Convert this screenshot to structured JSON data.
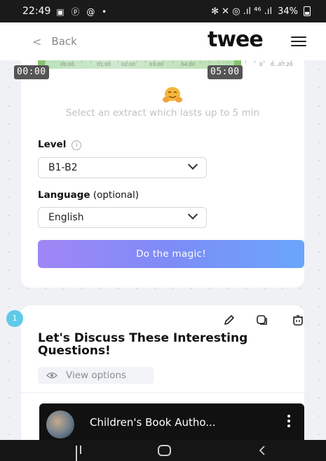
{
  "status_bar": {
    "time": "22:49",
    "notification_icons": "▣ ⓟ @ •",
    "connectivity": "✻ ✕ ◎ .ıl ⁴⁶ .ıl",
    "battery_percent": "34%"
  },
  "header": {
    "back_label": "Back",
    "logo_text": "twee",
    "menu_icon": "hamburger-icon"
  },
  "timeline": {
    "tick_labels": [
      "00:00",
      "01:00",
      "02:00",
      "03:00",
      "04:00",
      "0",
      "0...07:20"
    ],
    "start_chip": "00:00",
    "end_chip": "05:00",
    "selection_color": "#86c46f"
  },
  "extract": {
    "hint": "Select an extract which lasts up to 5 min",
    "emoji": "hugging-face-emoji"
  },
  "level": {
    "label": "Level",
    "info_icon": "i",
    "value": "B1-B2"
  },
  "language": {
    "label": "Language",
    "optional": " (optional)",
    "value": "English"
  },
  "magic_button": {
    "label": "Do the magic!",
    "gradient": [
      "#9f86f5",
      "#6aa6fb"
    ]
  },
  "task": {
    "step": "1",
    "title": "Let's Discuss These Interesting Questions!",
    "view_options": "View options",
    "tools": [
      "pencil-icon",
      "copy-icon",
      "trash-icon"
    ]
  },
  "video": {
    "title": "Children's Book Autho..."
  },
  "nav": {
    "buttons": [
      "recent-apps",
      "home",
      "back"
    ]
  }
}
